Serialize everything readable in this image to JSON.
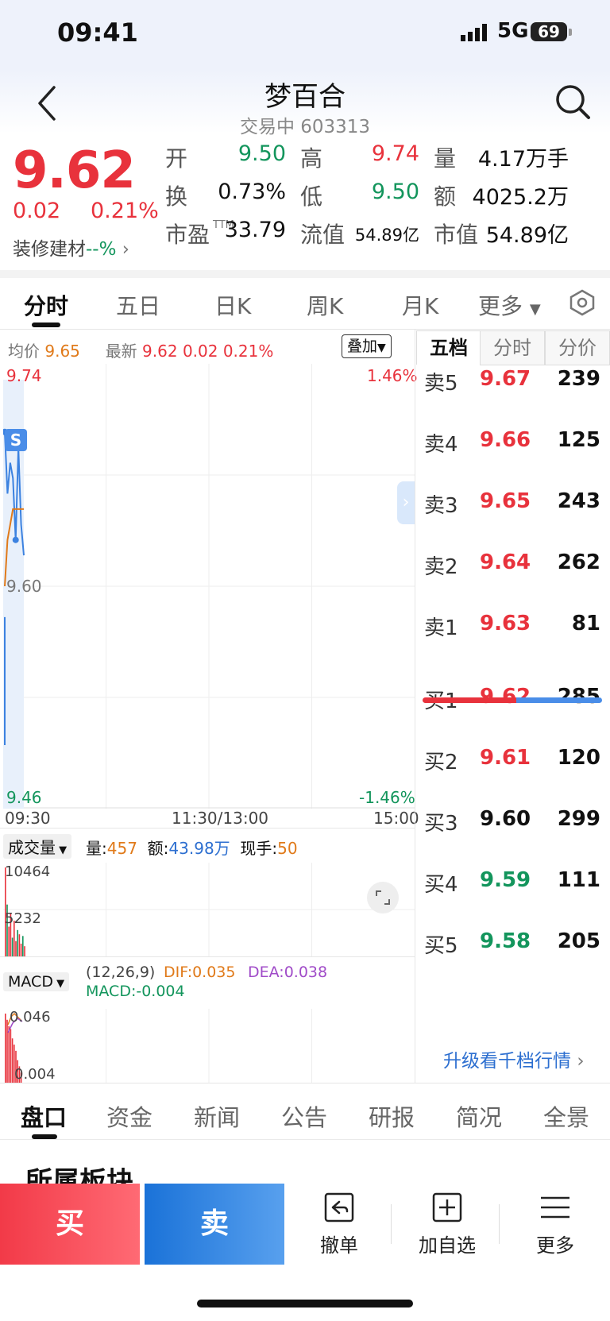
{
  "status_bar": {
    "time": "09:41",
    "network": "5G",
    "battery": "69"
  },
  "header": {
    "name": "梦百合",
    "status": "交易中",
    "code": "603313"
  },
  "quote": {
    "price": "9.62",
    "change": "0.02",
    "change_pct": "0.21%",
    "sector_name": "装修建材",
    "sector_change": "--%",
    "stats": [
      {
        "label": "开",
        "value": "9.50",
        "color": "green"
      },
      {
        "label": "高",
        "value": "9.74",
        "color": "red"
      },
      {
        "label": "量",
        "value": "4.17万手",
        "color": "dark"
      },
      {
        "label": "换",
        "value": "0.73%",
        "color": "dark"
      },
      {
        "label": "低",
        "value": "9.50",
        "color": "green"
      },
      {
        "label": "额",
        "value": "4025.2万",
        "color": "dark"
      },
      {
        "label": "市盈",
        "sup": "TTM",
        "value": "33.79",
        "color": "dark"
      },
      {
        "label": "流值",
        "value": "54.89亿",
        "color": "dark"
      },
      {
        "label": "市值",
        "value": "54.89亿",
        "color": "dark"
      }
    ]
  },
  "chart_tabs": [
    "分时",
    "五日",
    "日K",
    "周K",
    "月K",
    "更多"
  ],
  "chart_info": {
    "avg_label": "均价",
    "avg_value": "9.65",
    "latest_label": "最新",
    "latest_value": "9.62",
    "latest_change": "0.02",
    "latest_pct": "0.21%",
    "overlay_button": "叠加"
  },
  "chart_axis": {
    "y_top": "9.74",
    "y_mid": "9.60",
    "y_bottom": "9.46",
    "pct_top": "1.46%",
    "pct_bottom": "-1.46%",
    "x_start": "09:30",
    "x_mid": "11:30/13:00",
    "x_end": "15:00",
    "signal_badge": "S"
  },
  "chart_data": [
    {
      "type": "line",
      "series": [
        {
          "name": "最新",
          "values": [
            9.7,
            9.66,
            9.68,
            9.67,
            9.63,
            9.69,
            9.64,
            9.62
          ]
        },
        {
          "name": "均价",
          "values": [
            9.6,
            9.63,
            9.64,
            9.65,
            9.65,
            9.65,
            9.65,
            9.65
          ]
        }
      ],
      "ylim": [
        9.46,
        9.74
      ],
      "ytick_labels": [
        "9.74",
        "9.60",
        "9.46"
      ],
      "xtick_labels": [
        "09:30",
        "11:30/13:00",
        "15:00"
      ]
    },
    {
      "type": "bar",
      "values": [
        10464,
        6100,
        3500,
        5000,
        2200,
        4200,
        1800,
        3100,
        2600,
        1500,
        2400,
        1200
      ],
      "ylim": [
        0,
        10464
      ],
      "ytick_labels": [
        "10464",
        "5232"
      ]
    },
    {
      "type": "bar",
      "values": [
        0.046,
        0.042,
        0.038,
        0.036,
        0.03,
        0.026,
        0.022,
        0.016,
        0.012,
        0.008
      ],
      "ylim": [
        0.004,
        0.046
      ],
      "ytick_labels": [
        "0.046",
        "0.004"
      ]
    }
  ],
  "volume": {
    "selector": "成交量",
    "vol_label": "量:",
    "vol_value": "457",
    "amt_label": "额:",
    "amt_value": "43.98万",
    "hand_label": "现手:",
    "hand_value": "50",
    "y_top": "10464",
    "y_mid": "5232"
  },
  "macd": {
    "selector": "MACD",
    "params": "(12,26,9)",
    "dif": "DIF:0.035",
    "dea": "DEA:0.038",
    "macd": "MACD:-0.004",
    "y_top": "0.046",
    "y_bottom": "0.004"
  },
  "order_book": {
    "tabs": [
      "五档",
      "分时",
      "分价"
    ],
    "asks": [
      {
        "label": "卖5",
        "price": "9.67",
        "vol": "239"
      },
      {
        "label": "卖4",
        "price": "9.66",
        "vol": "125"
      },
      {
        "label": "卖3",
        "price": "9.65",
        "vol": "243"
      },
      {
        "label": "卖2",
        "price": "9.64",
        "vol": "262"
      },
      {
        "label": "卖1",
        "price": "9.63",
        "vol": "81"
      }
    ],
    "bids": [
      {
        "label": "买1",
        "price": "9.62",
        "vol": "285",
        "color": "red"
      },
      {
        "label": "买2",
        "price": "9.61",
        "vol": "120",
        "color": "red"
      },
      {
        "label": "买3",
        "price": "9.60",
        "vol": "299",
        "color": "dark"
      },
      {
        "label": "买4",
        "price": "9.59",
        "vol": "111",
        "color": "green"
      },
      {
        "label": "买5",
        "price": "9.58",
        "vol": "205",
        "color": "green"
      }
    ],
    "bid_share": 0.52,
    "upgrade_link": "升级看千档行情"
  },
  "bottom_tabs": [
    "盘口",
    "资金",
    "新闻",
    "公告",
    "研报",
    "简况",
    "全景"
  ],
  "section_title": "所属板块",
  "actions": {
    "buy": "买",
    "sell": "卖",
    "cancel": "撤单",
    "watchlist": "加自选",
    "more": "更多"
  },
  "colors": {
    "up": "#e8323c",
    "down": "#13955c",
    "accent": "#2d6fd0",
    "avg_line": "#e07a1a"
  }
}
